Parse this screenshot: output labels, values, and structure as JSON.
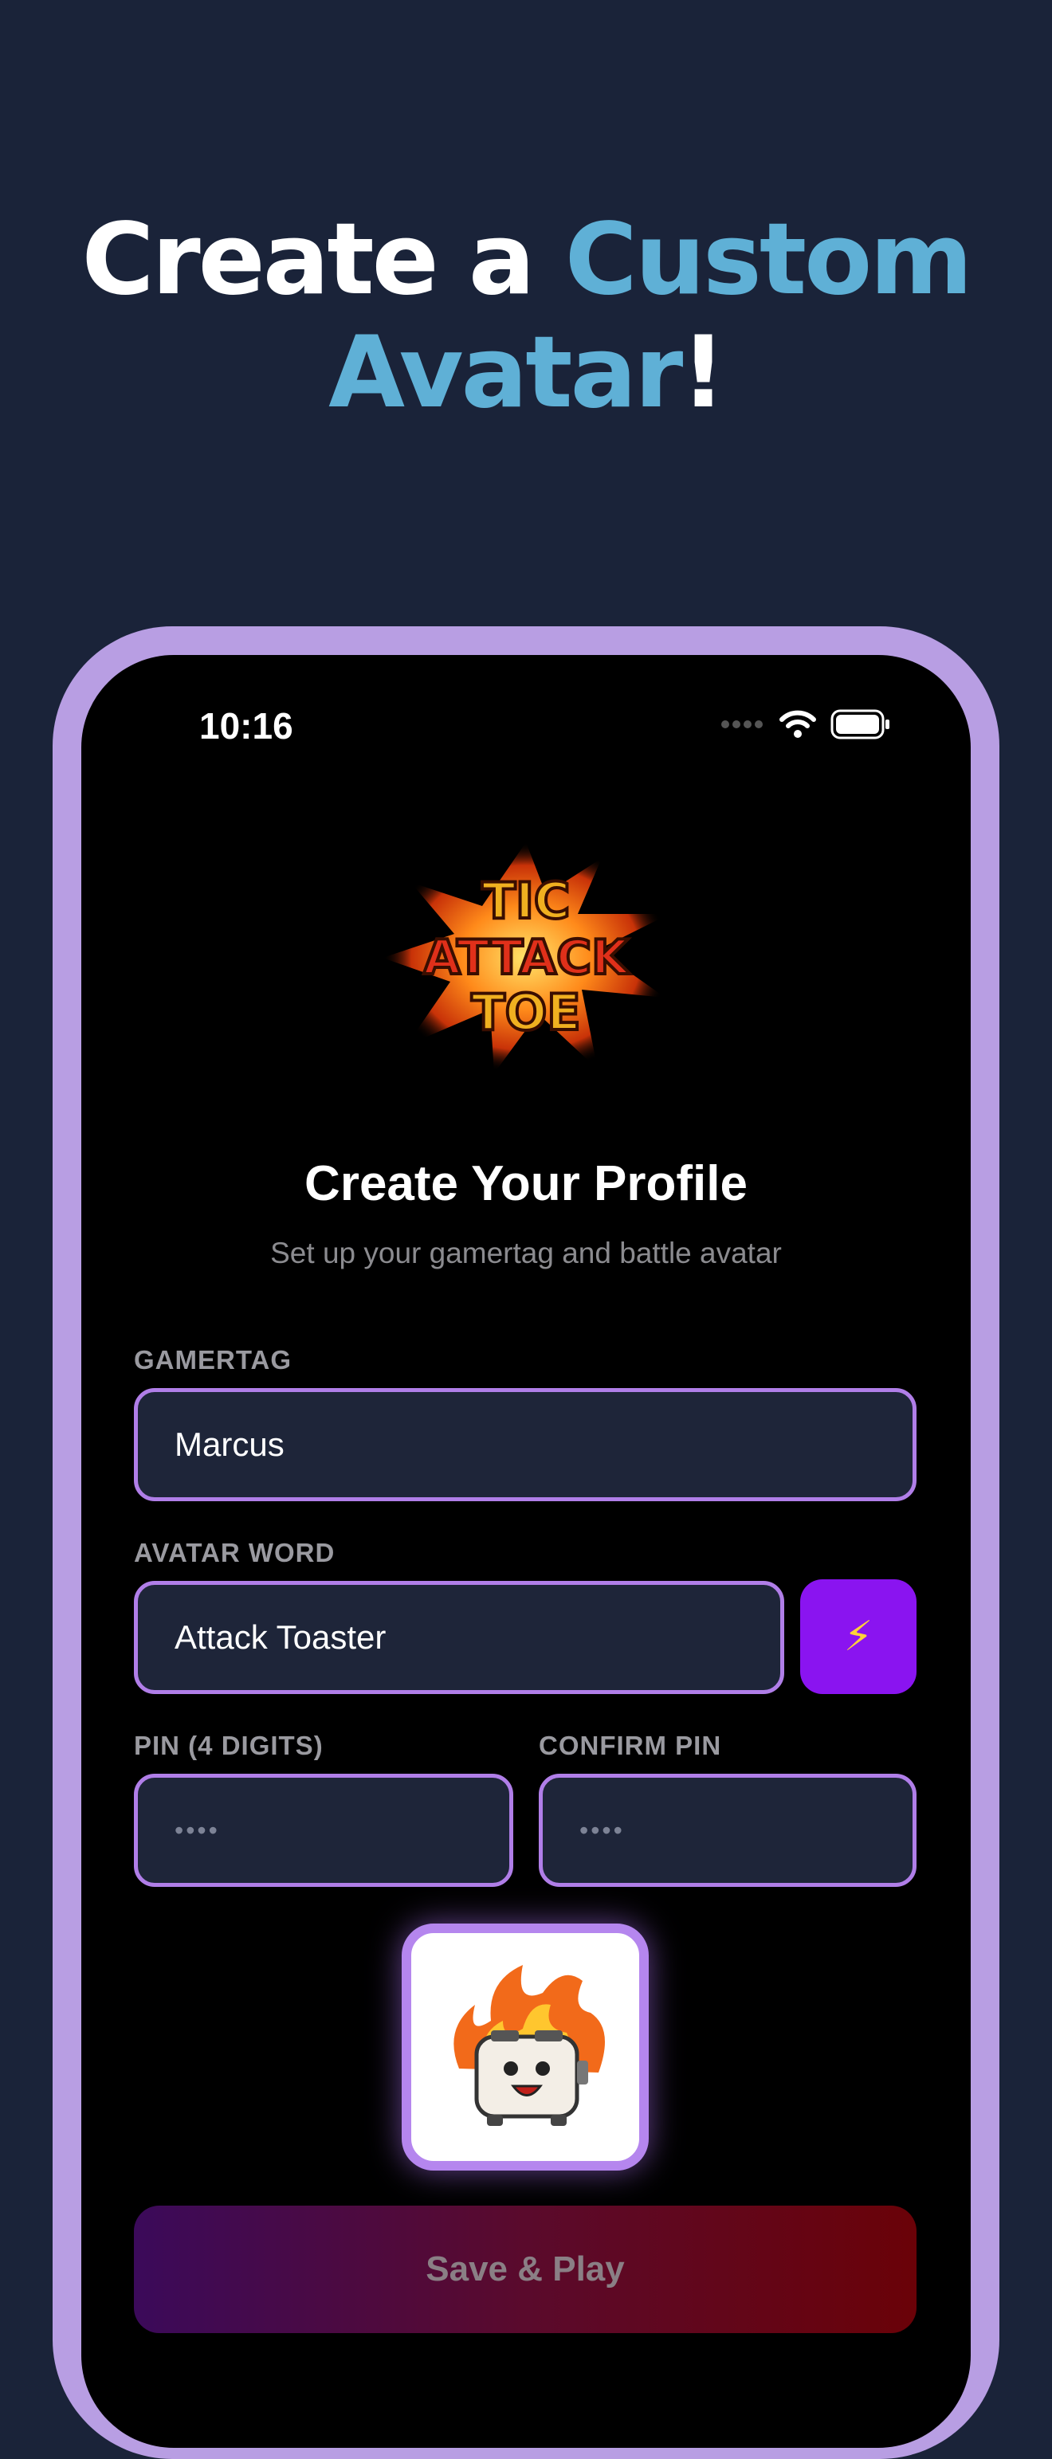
{
  "headline": {
    "line1_white": "Create a ",
    "line1_accent": "Custom",
    "line2_accent": "Avatar",
    "line2_white": "!"
  },
  "status_bar": {
    "time": "10:16"
  },
  "logo_text": [
    "TIC",
    "ATTACK",
    "TOE"
  ],
  "profile": {
    "title": "Create Your Profile",
    "subtitle": "Set up your gamertag and battle avatar"
  },
  "form": {
    "gamertag_label": "GAMERTAG",
    "gamertag_value": "Marcus",
    "avatar_word_label": "AVATAR WORD",
    "avatar_word_value": "Attack Toaster",
    "pin_label": "PIN (4 DIGITS)",
    "pin_placeholder": "••••",
    "confirm_pin_label": "CONFIRM PIN",
    "confirm_pin_placeholder": "••••",
    "generate_icon": "lightning-bolt-icon",
    "generate_glyph": "⚡"
  },
  "save_button": "Save & Play",
  "colors": {
    "background": "#1a2339",
    "accent_text": "#5fb0d6",
    "phone_frame": "#b89ee3",
    "field_border": "#b07ee8",
    "bolt_button": "#8a14f0"
  }
}
